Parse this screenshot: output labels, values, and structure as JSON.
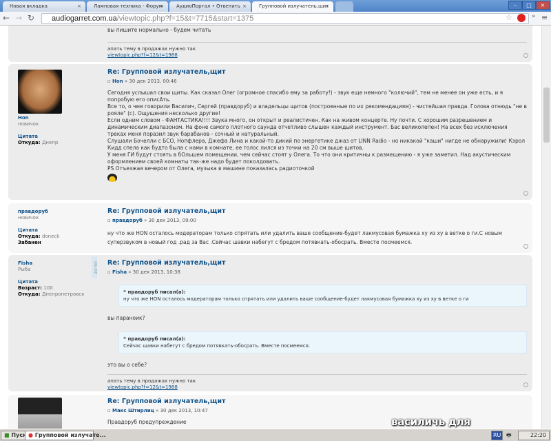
{
  "browser": {
    "tabs": [
      {
        "label": "Новая вкладка"
      },
      {
        "label": "Ламповая техника - Форум"
      },
      {
        "label": "АудиоПортал • Ответить"
      },
      {
        "label": "Групповой излучатель,щит"
      }
    ],
    "url_host": "audiogarret.com.ua",
    "url_path": "/viewtopic.php?f=15&t=7715&start=1375"
  },
  "signature": {
    "text": "апать тему в продажах нужно так",
    "link": "viewtopic.php?f=12&t=1988"
  },
  "post0": {
    "text": "вы пишите нормально - будем читать"
  },
  "post1": {
    "title": "Re: Групповой излучатель,щит",
    "author": "Hon",
    "date": "» 30 дек 2013, 00:46",
    "rank": "новичок",
    "quote_label": "Цитата",
    "from_label": "Откуда:",
    "from": "Днепр",
    "lines": [
      "Сегодня услышал свои щиты. Как сказал Олег (огромное спасибо ему за работу!) - звук еще немного \"колючий\", тем не менее он уже есть, и я попробую его описАть.",
      "Все то, о чем говорили Василич, Сергей (правдоруб) и владельцы щитов (построенные по их рекомендациям) - чистейшая правда. Голова отнюдь \"не в рояле\" (с). Ощущения несколько другие!",
      "Если одним словом - ФАНТАСТИКА!!!! Звука много, он открыт и реалистичен. Как на живом концерте. Ну почти. С хорошим разрешением и динамическим диапазоном. На фоне самого плотного саунда отчетливо слышен каждый инструмент. Бас великолепен! На всех без исключения треках меня поразил звук барабанов - сочный и натуральный.",
      "Слушали Бочелли с БСО, Нопфлера, Джефа Лина и какой-то дикий по энергетике джаз от LINN Radio - но никакой \"каши\" нигде не обнаружили! Кэрол Кидд спела как будто была с нами в комнате, ее голос лился из точки на 20 см выше щитов.",
      "У меня ГИ будут стоять в бОльшем помещении, чем сейчас стоят у Олега. То что они критичны к размещению - я уже заметил. Над акустическим оформлением своей комнаты так-же надо будет поколдовать.",
      "PS Отъезжая вечером от Олега, музыка в машине показалась радиоточкой"
    ]
  },
  "post2": {
    "title": "Re: Групповой излучатель,щит",
    "author": "правдоруб",
    "date": "» 30 дек 2013, 09:00",
    "rank": "новичок",
    "quote_label": "Цитата",
    "from_label": "Откуда:",
    "from": "doneck",
    "banned": "Забанен",
    "text": "ну что же HON осталось модераторам только спрятать или удалить ваше сообщение-будет лакмусовая бумажка ху из ху в ветке о ги.С новым суперзвуком в новый год .рад за Вас .Сейчас шавки набегут с бредом потявкать-обосрать. Вместе посмеемся."
  },
  "post3": {
    "title": "Re: Групповой излучатель,щит",
    "author": "Fisha",
    "date": "» 30 дек 2013, 10:38",
    "rank": "Рыба",
    "online": "ONLINE",
    "quote_label": "Цитата",
    "age_label": "Возраст:",
    "age": "100",
    "from_label": "Откуда:",
    "from": "Днепропетровск",
    "q1_head": "правдоруб писал(а):",
    "q1_text": "ну что же HON осталось модераторам только спрятать или удалить ваше сообщение-будет лакмусовая бумажка ху из ху в ветке о ги",
    "t1": "вы параноик?",
    "q2_head": "правдоруб писал(а):",
    "q2_text": "Сейчас шавки набегут с бредом потявкать-обосрать. Вместе посмеемся.",
    "t2": "это вы о себе?"
  },
  "post4": {
    "title": "Re: Групповой излучатель,щит",
    "author": "Макс Штирлиц",
    "date": "» 30 дек 2013, 10:47",
    "text": "Правдоруб предупреждение"
  },
  "watermark": "василичь для forum.onliner.by",
  "taskbar": {
    "start": "Пуск",
    "window": "Групповой излучате...",
    "lang": "RU",
    "time": "22:20"
  }
}
